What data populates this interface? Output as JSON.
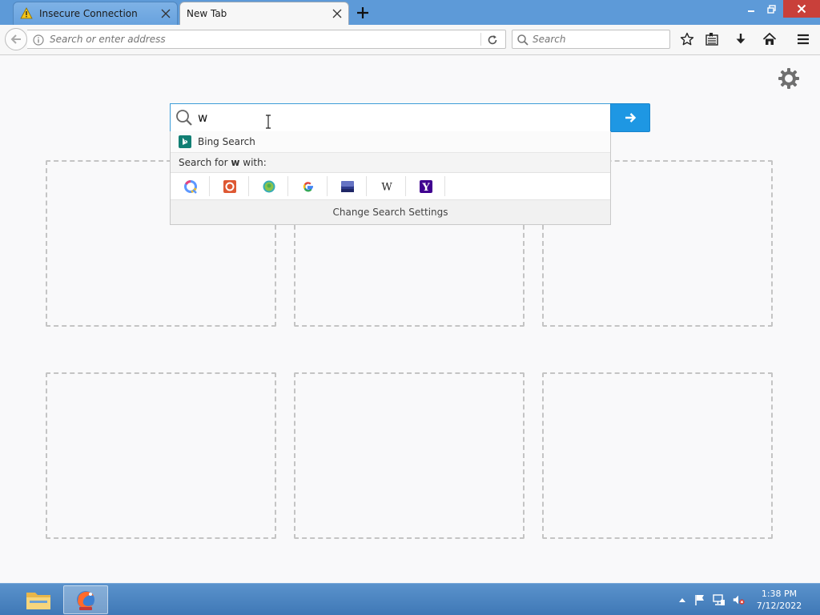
{
  "tabs": [
    {
      "label": "Insecure Connection",
      "icon": "warning-icon",
      "active": false
    },
    {
      "label": "New Tab",
      "active": true
    }
  ],
  "navbar": {
    "url_placeholder": "Search or enter address",
    "search_placeholder": "Search"
  },
  "newtab": {
    "query": "w",
    "suggestion": "Bing Search",
    "search_for_prefix": "Search for ",
    "search_for_term": "w",
    "search_for_suffix": " with:",
    "engines": [
      "qwant",
      "duckduckgo",
      "ecosia",
      "google",
      "startpage",
      "wikipedia",
      "yahoo"
    ],
    "change_settings": "Change Search Settings",
    "tile_count": 6
  },
  "taskbar": {
    "time": "1:38 PM",
    "date": "7/12/2022"
  },
  "colors": {
    "titlebar": "#5d9ad8",
    "accent": "#1e97e3",
    "close": "#c9403a"
  }
}
